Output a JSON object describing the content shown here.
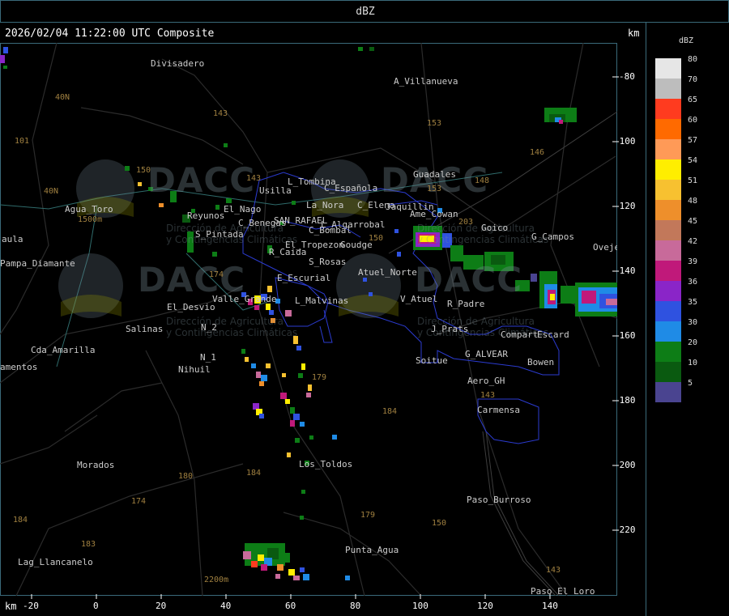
{
  "header": {
    "title": "dBZ"
  },
  "map_header": {
    "timestamp": "2026/02/04 11:22:00 UTC Composite",
    "unit_top": "km",
    "unit_bottom": "km"
  },
  "y_axis_ticks": [
    "-80",
    "-100",
    "-120",
    "-140",
    "-160",
    "-180",
    "-200",
    "-220"
  ],
  "x_axis_ticks": [
    "-20",
    "0",
    "20",
    "40",
    "60",
    "80",
    "100",
    "120",
    "140"
  ],
  "legend": {
    "title": "dBZ",
    "entries": [
      {
        "label": "80",
        "color": "#e6e6e6"
      },
      {
        "label": "70",
        "color": "#bdbdbd"
      },
      {
        "label": "65",
        "color": "#ff3b1f"
      },
      {
        "label": "60",
        "color": "#ff6a00"
      },
      {
        "label": "57",
        "color": "#ff9a57"
      },
      {
        "label": "54",
        "color": "#ffee00"
      },
      {
        "label": "51",
        "color": "#f7c130"
      },
      {
        "label": "48",
        "color": "#ee8f2b"
      },
      {
        "label": "45",
        "color": "#c2785a"
      },
      {
        "label": "42",
        "color": "#c86a9a"
      },
      {
        "label": "39",
        "color": "#c0197a"
      },
      {
        "label": "36",
        "color": "#8a25c8"
      },
      {
        "label": "35",
        "color": "#2f52e0"
      },
      {
        "label": "30",
        "color": "#1f8be6"
      },
      {
        "label": "20",
        "color": "#0d7d16"
      },
      {
        "label": "10",
        "color": "#0a5a10"
      },
      {
        "label": "5",
        "color": "#4a4490"
      }
    ]
  },
  "watermark": {
    "brand": "DACC",
    "line1": "Dirección de Agricultura",
    "line2": "y Contingencias Climáticas"
  },
  "places": [
    {
      "name": "Divisadero"
    },
    {
      "name": "A_Villanueva"
    },
    {
      "name": "Guadales"
    },
    {
      "name": "L_Tombina"
    },
    {
      "name": "C_Española"
    },
    {
      "name": "Usilla"
    },
    {
      "name": "La_Nora"
    },
    {
      "name": "C_Elena"
    },
    {
      "name": "Jaquillin"
    },
    {
      "name": "Ame_Cowan"
    },
    {
      "name": "Agua_Toro"
    },
    {
      "name": "Reyunos"
    },
    {
      "name": "El_Nago"
    },
    {
      "name": "C_Benegas"
    },
    {
      "name": "SAN_RAFAEL"
    },
    {
      "name": "L_Algarrobal"
    },
    {
      "name": "C_Bombal"
    },
    {
      "name": "Goico"
    },
    {
      "name": "G_Campos"
    },
    {
      "name": "Oveje"
    },
    {
      "name": "S_Pintada"
    },
    {
      "name": "El_Tropezon"
    },
    {
      "name": "Goudge"
    },
    {
      "name": "R_Caida"
    },
    {
      "name": "S_Rosas"
    },
    {
      "name": "Atuel_Norte"
    },
    {
      "name": "aula"
    },
    {
      "name": "Pampa_Diamante"
    },
    {
      "name": "E_Escurial"
    },
    {
      "name": "Valle_Grande"
    },
    {
      "name": "L_Malvinas"
    },
    {
      "name": "V_Atuel"
    },
    {
      "name": "R_Padre"
    },
    {
      "name": "El_Desvio"
    },
    {
      "name": "Salinas"
    },
    {
      "name": "N_2"
    },
    {
      "name": "J_Prats"
    },
    {
      "name": "Compart"
    },
    {
      "name": "Escard"
    },
    {
      "name": "Cda_Amarilla"
    },
    {
      "name": "N_1"
    },
    {
      "name": "amentos"
    },
    {
      "name": "Nihuil"
    },
    {
      "name": "G_ALVEAR"
    },
    {
      "name": "Soitue"
    },
    {
      "name": "Bowen"
    },
    {
      "name": "Aero_GH"
    },
    {
      "name": "Carmensa"
    },
    {
      "name": "Morados"
    },
    {
      "name": "Los_Toldos"
    },
    {
      "name": "Paso_Burroso"
    },
    {
      "name": "Lag_Llancanelo"
    },
    {
      "name": "Punta_Agua"
    },
    {
      "name": "Paso_El_Loro"
    }
  ],
  "contour_labels": [
    "143",
    "153",
    "101",
    "150",
    "146",
    "148",
    "203",
    "153",
    "150",
    "143",
    "174",
    "179",
    "184",
    "180",
    "184",
    "174",
    "179",
    "150",
    "143",
    "184",
    "183",
    "143",
    "2200m",
    "1500m",
    "40N",
    "40N"
  ]
}
